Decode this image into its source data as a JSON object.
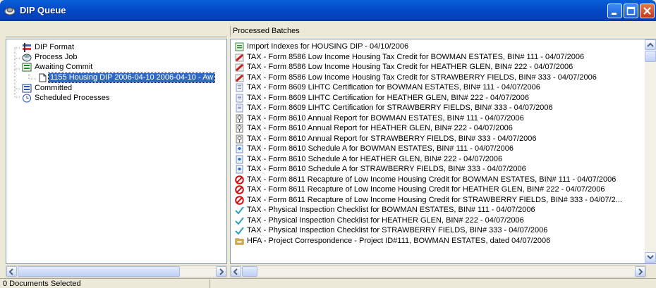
{
  "window": {
    "title": "DIP Queue"
  },
  "tree": {
    "items": [
      {
        "label": "DIP Format",
        "icon": "dip-format-icon"
      },
      {
        "label": "Process Job",
        "icon": "process-job-icon"
      },
      {
        "label": "Awaiting Commit",
        "icon": "awaiting-commit-icon"
      },
      {
        "label": "1155 Housing DIP 2006-04-10  2006-04-10 - Aw",
        "icon": "document-icon",
        "selected": true
      },
      {
        "label": "Committed",
        "icon": "committed-icon"
      },
      {
        "label": "Scheduled Processes",
        "icon": "clock-icon"
      }
    ]
  },
  "batches": {
    "header": "Processed Batches",
    "rows": [
      {
        "label": "Import Indexes for HOUSING DIP - 04/10/2006",
        "icon": "import-index-icon"
      },
      {
        "label": "TAX - Form 8586 Low Income Housing Tax Credit for BOWMAN ESTATES, BIN# 111 - 04/07/2006",
        "icon": "pencil-form-icon"
      },
      {
        "label": "TAX - Form 8586 Low Income Housing Tax Credit for HEATHER GLEN, BIN# 222 - 04/07/2006",
        "icon": "pencil-form-icon"
      },
      {
        "label": "TAX - Form 8586 Low Income Housing Tax Credit for STRAWBERRY FIELDS, BIN# 333 - 04/07/2006",
        "icon": "pencil-form-icon"
      },
      {
        "label": "TAX - Form 8609 LIHTC Certification for BOWMAN ESTATES, BIN# 111 - 04/07/2006",
        "icon": "certificate-icon"
      },
      {
        "label": "TAX - Form 8609 LIHTC Certification for HEATHER GLEN, BIN# 222 - 04/07/2006",
        "icon": "certificate-icon"
      },
      {
        "label": "TAX - Form 8609 LIHTC Certification for STRAWBERRY FIELDS, BIN# 333 - 04/07/2006",
        "icon": "certificate-icon"
      },
      {
        "label": "TAX - Form 8610 Annual Report for BOWMAN ESTATES, BIN# 111 - 04/07/2006",
        "icon": "annual-report-icon"
      },
      {
        "label": "TAX - Form 8610 Annual Report for HEATHER GLEN, BIN# 222 - 04/07/2006",
        "icon": "annual-report-icon"
      },
      {
        "label": "TAX - Form 8610 Annual Report for STRAWBERRY FIELDS, BIN# 333 - 04/07/2006",
        "icon": "annual-report-icon"
      },
      {
        "label": "TAX - Form 8610 Schedule A for BOWMAN ESTATES, BIN# 111 - 04/07/2006",
        "icon": "schedule-icon"
      },
      {
        "label": "TAX - Form 8610 Schedule A for HEATHER GLEN, BIN# 222 - 04/07/2006",
        "icon": "schedule-icon"
      },
      {
        "label": "TAX - Form 8610 Schedule A for STRAWBERRY FIELDS, BIN# 333 - 04/07/2006",
        "icon": "schedule-icon"
      },
      {
        "label": "TAX - Form 8611 Recapture of Low Income Housing Credit for BOWMAN ESTATES, BIN# 111 - 04/07/2006",
        "icon": "prohibited-icon"
      },
      {
        "label": "TAX - Form 8611 Recapture of Low Income Housing Credit for HEATHER GLEN, BIN# 222 - 04/07/2006",
        "icon": "prohibited-icon"
      },
      {
        "label": "TAX - Form 8611 Recapture of Low Income Housing Credit for STRAWBERRY FIELDS, BIN# 333 - 04/07/2...",
        "icon": "prohibited-icon"
      },
      {
        "label": "TAX - Physical Inspection Checklist for BOWMAN ESTATES, BIN# 111 - 04/07/2006",
        "icon": "checkmark-icon"
      },
      {
        "label": "TAX - Physical Inspection Checklist for HEATHER GLEN, BIN# 222 - 04/07/2006",
        "icon": "checkmark-icon"
      },
      {
        "label": "TAX - Physical Inspection Checklist for STRAWBERRY FIELDS, BIN# 333 - 04/07/2006",
        "icon": "checkmark-icon"
      },
      {
        "label": "HFA - Project Correspondence - Project ID#111, BOWMAN ESTATES, dated 04/07/2006",
        "icon": "folder-icon"
      }
    ]
  },
  "status": {
    "left": "0 Documents Selected"
  }
}
